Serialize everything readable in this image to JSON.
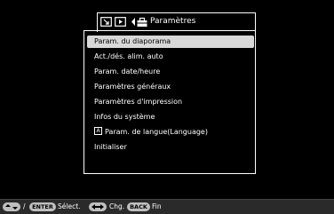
{
  "tabs": {
    "title": "Paramètres"
  },
  "menu": {
    "items": [
      {
        "label": "Param. du diaporama",
        "selected": true
      },
      {
        "label": "Act./dés. alim. auto",
        "selected": false
      },
      {
        "label": "Param. date/heure",
        "selected": false
      },
      {
        "label": "Paramètres généraux",
        "selected": false
      },
      {
        "label": "Paramètres d'impression",
        "selected": false
      },
      {
        "label": "Infos du système",
        "selected": false
      },
      {
        "label": "Param. de langue(Language)",
        "selected": false,
        "badge": "A"
      },
      {
        "label": "Initialiser",
        "selected": false
      }
    ]
  },
  "statusbar": {
    "slash": "/",
    "enter_key": "ENTER",
    "select_label": "Sélect.",
    "change_label": "Chg.",
    "back_key": "BACK",
    "end_label": "Fin"
  }
}
